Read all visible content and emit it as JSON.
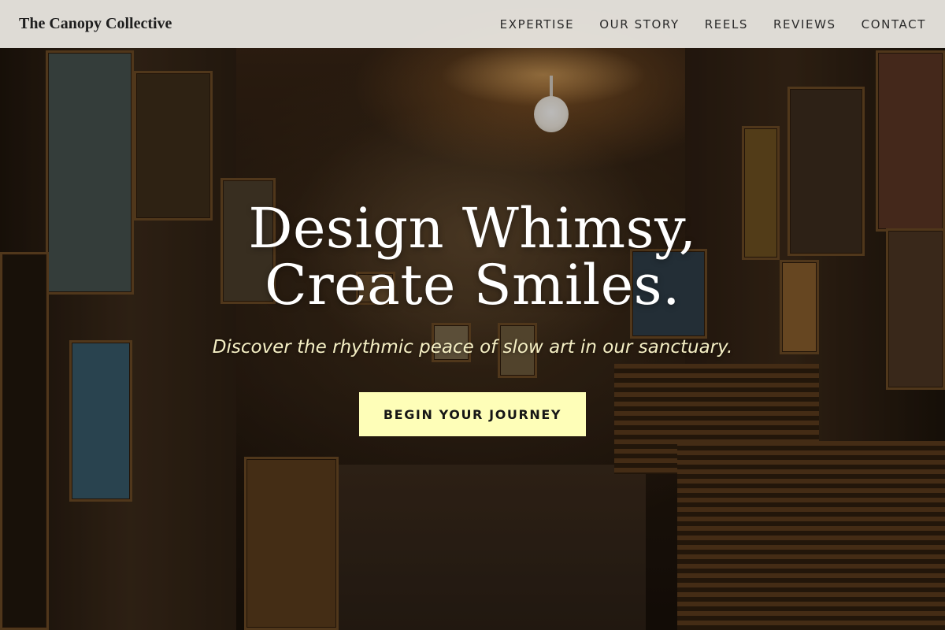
{
  "header": {
    "brand": "The Canopy Collective",
    "nav": [
      {
        "label": "EXPERTISE"
      },
      {
        "label": "OUR STORY"
      },
      {
        "label": "REELS"
      },
      {
        "label": "REVIEWS"
      },
      {
        "label": "CONTACT"
      }
    ]
  },
  "hero": {
    "title": "Design Whimsy, Create Smiles.",
    "subtitle": "Discover the rhythmic peace of slow art in our sanctuary.",
    "cta_label": "BEGIN YOUR JOURNEY",
    "background_image": "dim art studio storage room with stacked canvases and framed paintings"
  },
  "colors": {
    "header_bg": "#eeece6",
    "cta_bg": "#fefeb8",
    "title_text": "#ffffff",
    "subtitle_text": "#f5efc4"
  }
}
